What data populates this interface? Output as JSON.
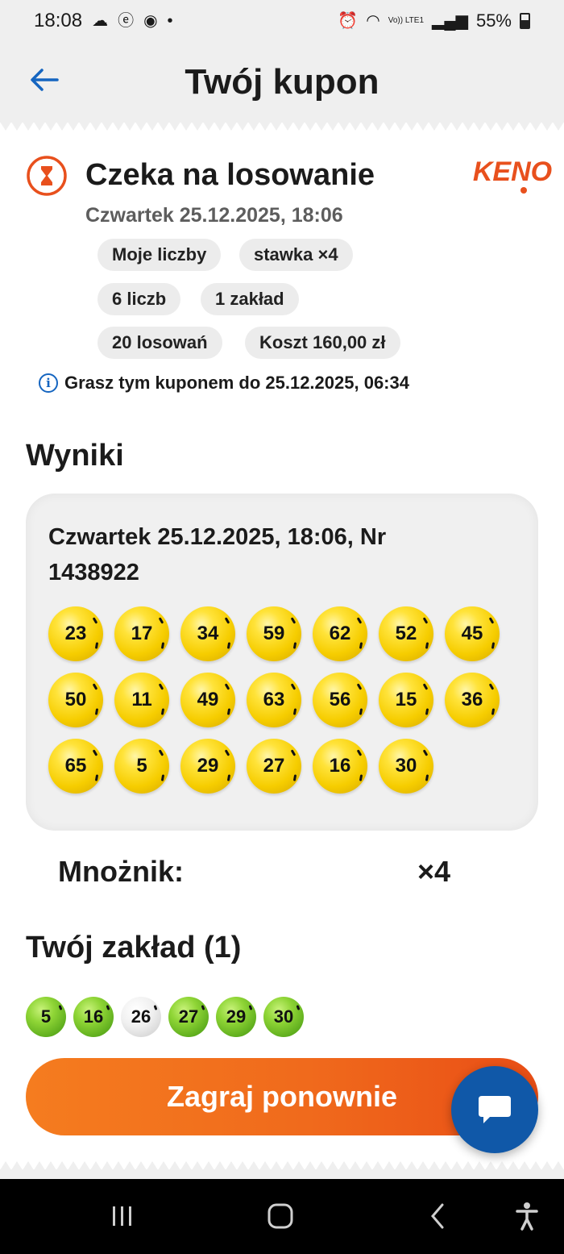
{
  "status_bar": {
    "time": "18:08",
    "battery": "55%",
    "network": "Vo)) LTE1"
  },
  "header": {
    "title": "Twój kupon"
  },
  "ticket": {
    "status": "Czeka na losowanie",
    "datetime": "Czwartek 25.12.2025, 18:06",
    "brand": "KENO",
    "chips": [
      "Moje liczby",
      "stawka ×4",
      "6 liczb",
      "1 zakład",
      "20 losowań",
      "Koszt 160,00 zł"
    ],
    "info": "Grasz tym kuponem do 25.12.2025, 06:34"
  },
  "results": {
    "title": "Wyniki",
    "draw_heading": "Czwartek 25.12.2025, 18:06, Nr 1438922",
    "numbers": [
      "23",
      "17",
      "34",
      "59",
      "62",
      "52",
      "45",
      "50",
      "11",
      "49",
      "63",
      "56",
      "15",
      "36",
      "65",
      "5",
      "29",
      "27",
      "16",
      "30"
    ]
  },
  "multiplier": {
    "label": "Mnożnik:",
    "value": "×4"
  },
  "bet": {
    "title": "Twój zakład (1)",
    "numbers": [
      {
        "value": "5",
        "hit": true
      },
      {
        "value": "16",
        "hit": true
      },
      {
        "value": "26",
        "hit": false
      },
      {
        "value": "27",
        "hit": true
      },
      {
        "value": "29",
        "hit": true
      },
      {
        "value": "30",
        "hit": true
      }
    ]
  },
  "actions": {
    "play_again": "Zagraj ponownie"
  },
  "colors": {
    "accent_orange": "#e8501d",
    "brand_blue": "#1058a8",
    "ball_yellow": "#f6cd00",
    "ball_green": "#6cbf22"
  }
}
